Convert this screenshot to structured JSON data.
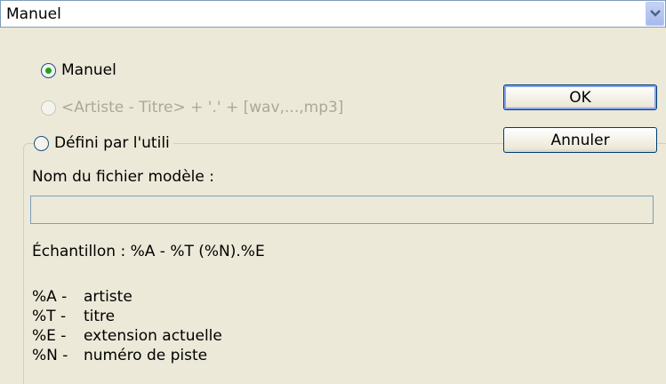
{
  "combo": {
    "value": "Manuel"
  },
  "options": {
    "manuel": "Manuel",
    "artist_title": "<Artiste - Titre> + '.' + [wav,...,mp3]",
    "user_defined": "Défini par l'utili"
  },
  "buttons": {
    "ok": "OK",
    "cancel": "Annuler"
  },
  "template": {
    "label": "Nom du fichier modèle :",
    "value": "",
    "sample": "Échantillon : %A - %T (%N).%E"
  },
  "legend": [
    {
      "code": "%A -",
      "desc": "artiste"
    },
    {
      "code": "%T -",
      "desc": "titre"
    },
    {
      "code": "%E -",
      "desc": "extension actuelle"
    },
    {
      "code": "%N -",
      "desc": "numéro de piste"
    }
  ],
  "colors": {
    "radio_selected": "#21a121",
    "disabled_text": "#aca899",
    "border": "#7f9db9"
  },
  "icons": {
    "dropdown": "chevron-down-icon"
  }
}
